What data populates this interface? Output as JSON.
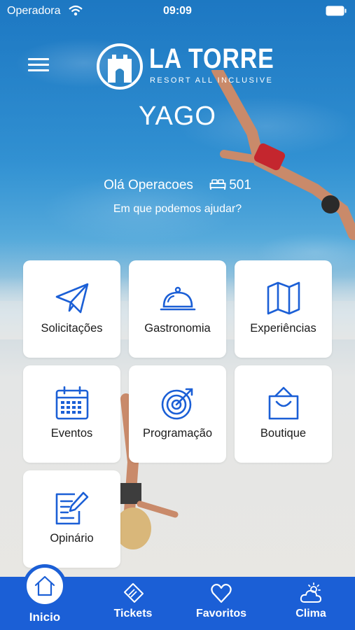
{
  "status_bar": {
    "carrier": "Operadora",
    "time": "09:09"
  },
  "logo": {
    "title": "LA TORRE",
    "subtitle": "RESORT ALL INCLUSIVE"
  },
  "user": {
    "name": "YAGO",
    "greeting": "Olá Operacoes",
    "room": "501"
  },
  "help_text": "Em que podemos ajudar?",
  "tiles": [
    {
      "label": "Solicitações",
      "icon": "paper-plane-icon"
    },
    {
      "label": "Gastronomia",
      "icon": "cloche-icon"
    },
    {
      "label": "Experiências",
      "icon": "map-icon"
    },
    {
      "label": "Eventos",
      "icon": "calendar-icon"
    },
    {
      "label": "Programação",
      "icon": "target-icon"
    },
    {
      "label": "Boutique",
      "icon": "shopping-bag-icon"
    },
    {
      "label": "Opinário",
      "icon": "edit-document-icon"
    }
  ],
  "tabs": [
    {
      "label": "Inicio",
      "icon": "home-icon",
      "active": true
    },
    {
      "label": "Tickets",
      "icon": "ticket-icon"
    },
    {
      "label": "Favoritos",
      "icon": "heart-icon"
    },
    {
      "label": "Clima",
      "icon": "weather-icon"
    }
  ],
  "colors": {
    "accent": "#1b5fd6",
    "icon": "#1b5fd6",
    "tile_bg": "#ffffff",
    "text": "#1b1b1b"
  }
}
